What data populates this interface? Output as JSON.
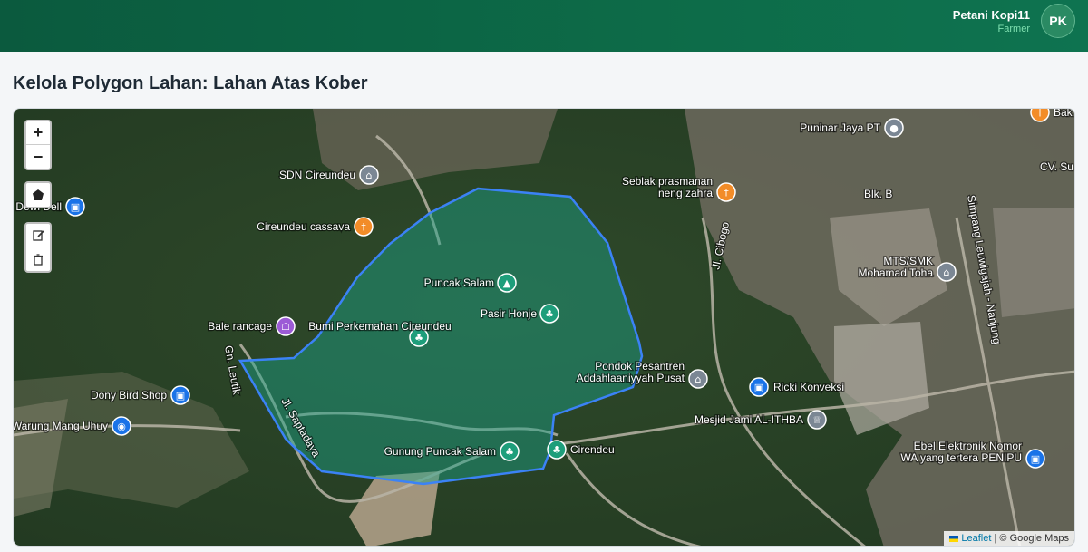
{
  "header": {
    "user_name": "Petani Kopi11",
    "user_role": "Farmer",
    "avatar_initials": "PK"
  },
  "page": {
    "title": "Kelola Polygon Lahan: Lahan Atas Kober"
  },
  "map": {
    "controls": {
      "zoom_in": "+",
      "zoom_out": "−",
      "draw_polygon_icon": "pentagon-icon",
      "edit_icon": "edit-icon",
      "delete_icon": "trash-icon"
    },
    "polygon_color": "#3b82f6",
    "polygon_fill": "#1aa38a",
    "places": [
      {
        "id": "sdn",
        "label": "SDN Cireundeu",
        "icon": "school-icon",
        "color": "#7b8794"
      },
      {
        "id": "cassava",
        "label": "Cireundeu cassava",
        "icon": "restaurant-icon",
        "color": "#f28c28"
      },
      {
        "id": "dell",
        "label": "Dewi Dell",
        "icon": "shop-icon",
        "color": "#1a73e8"
      },
      {
        "id": "bale",
        "label": "Bale rancage",
        "icon": "landmark-icon",
        "color": "#9c5bd6"
      },
      {
        "id": "bumi",
        "label": "Bumi Perkemahan Cireundeu",
        "icon": "park-icon",
        "color": "#1e9e7b"
      },
      {
        "id": "puncak",
        "label": "Puncak Salam",
        "icon": "campsite-icon",
        "color": "#1e9e7b"
      },
      {
        "id": "pasir",
        "label": "Pasir Honje",
        "icon": "park-icon",
        "color": "#1e9e7b"
      },
      {
        "id": "gunung",
        "label": "Gunung Puncak Salam",
        "icon": "park-icon",
        "color": "#1e9e7b"
      },
      {
        "id": "cirendeu",
        "label": "Cirendeu",
        "icon": "park-icon",
        "color": "#1e9e7b"
      },
      {
        "id": "dony",
        "label": "Dony Bird Shop",
        "icon": "shop-icon",
        "color": "#1a73e8"
      },
      {
        "id": "warung",
        "label": "Warung Mang Uhuy",
        "icon": "cart-icon",
        "color": "#1a73e8"
      },
      {
        "id": "puninar",
        "label": "Puninar Jaya PT",
        "icon": "pin-icon",
        "color": "#7b8794"
      },
      {
        "id": "seblak",
        "label": "Seblak prasmanan neng zahra",
        "icon": "restaurant-icon",
        "color": "#f28c28"
      },
      {
        "id": "mts",
        "label": "MTS/SMK Mohamad Toha",
        "icon": "school-icon",
        "color": "#7b8794"
      },
      {
        "id": "pondok",
        "label": "Pondok Pesantren Addahlaaniyyah Pusat",
        "icon": "school-icon",
        "color": "#7b8794"
      },
      {
        "id": "ricki",
        "label": "Ricki Konveksi",
        "icon": "shop-icon",
        "color": "#1a73e8"
      },
      {
        "id": "masjid",
        "label": "Mesjid Jami AL-ITHBA",
        "icon": "mosque-icon",
        "color": "#7b8794"
      },
      {
        "id": "ebel",
        "label": "Ebel Elektronik Nomor WA yang tertera PENIPU",
        "icon": "shop-icon",
        "color": "#1a73e8"
      },
      {
        "id": "bak",
        "label": "Bak",
        "icon": "restaurant-icon",
        "color": "#f28c28"
      }
    ],
    "road_labels": [
      "Jl. Saptadaya",
      "Gn. Leutik",
      "Jl. Cibogo",
      "Simpang Leuwigajah - Nanjung",
      "Blk. B",
      "CV. Su"
    ],
    "attribution": {
      "leaflet": "Leaflet",
      "separator": "|",
      "copyright": "© Google Maps"
    }
  }
}
